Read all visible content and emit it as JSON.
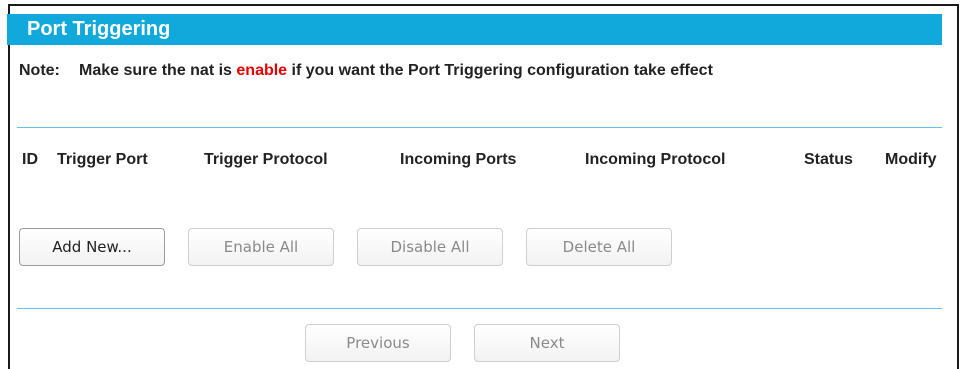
{
  "page": {
    "title": "Port Triggering",
    "note": {
      "label": "Note:",
      "text_before": "Make sure the nat is ",
      "highlight": "enable",
      "text_after": " if you want the Port Triggering configuration take effect",
      "highlight_color": "#e60000"
    }
  },
  "table": {
    "headers": {
      "id": "ID",
      "trigger_port": "Trigger Port",
      "trigger_protocol": "Trigger Protocol",
      "incoming_ports": "Incoming Ports",
      "incoming_protocol": "Incoming Protocol",
      "status": "Status",
      "modify": "Modify"
    },
    "rows": []
  },
  "actions": {
    "add_new": "Add New...",
    "enable_all": "Enable All",
    "disable_all": "Disable All",
    "delete_all": "Delete All"
  },
  "pagination": {
    "previous": "Previous",
    "next": "Next"
  },
  "colors": {
    "title_bar": "#11a8dc",
    "divider": "#62c3e8",
    "accent_text": "#e60000"
  }
}
